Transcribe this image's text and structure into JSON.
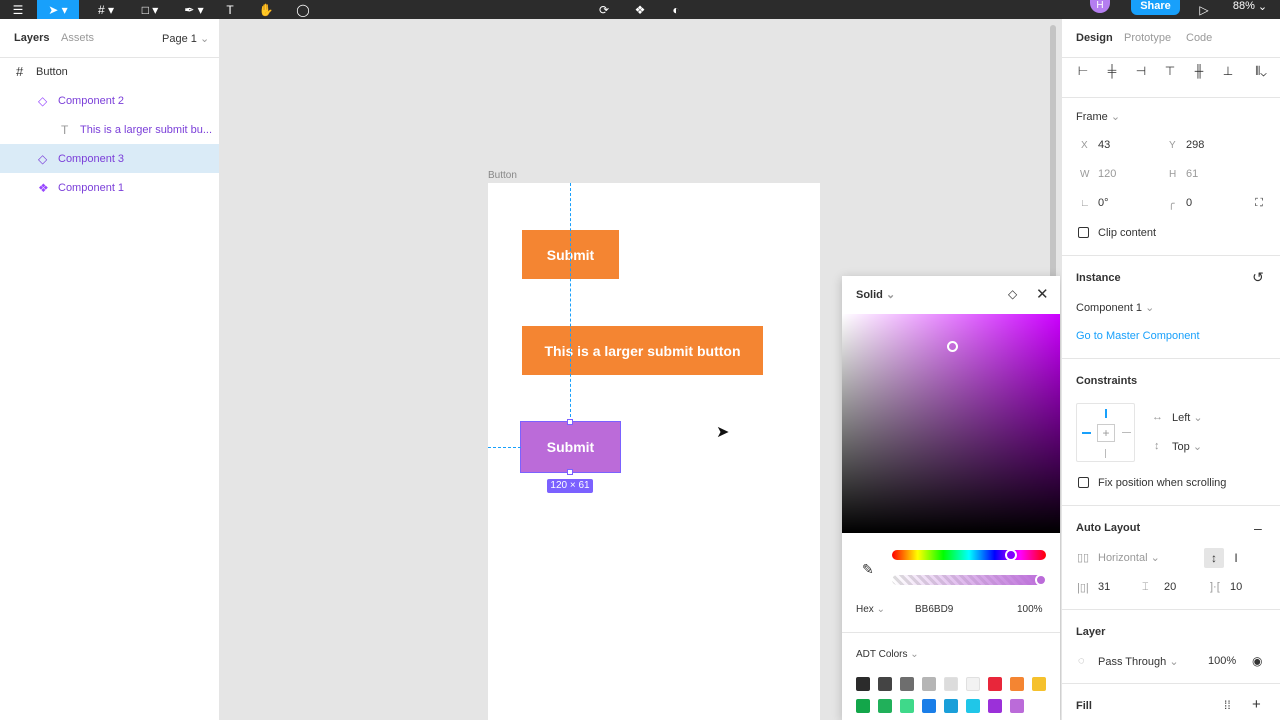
{
  "toolbar": {
    "icons": [
      "menu-icon",
      "move-tool-icon",
      "frame-tool-icon",
      "shape-tool-icon",
      "pen-tool-icon",
      "text-tool-icon",
      "hand-tool-icon",
      "comment-tool-icon"
    ],
    "center_icons": [
      "boolean-icon",
      "component-icon",
      "mask-icon"
    ],
    "avatar_letter": "H",
    "share_label": "Share",
    "zoom_label": "88%",
    "share_color": "#18a0fb",
    "avatar_color": "#b47ef0"
  },
  "left_panel": {
    "tabs": {
      "layers": "Layers",
      "assets": "Assets"
    },
    "page_selector": "Page 1",
    "layers": [
      {
        "icon": "frame-icon",
        "label": "Button"
      },
      {
        "icon": "component-instance-icon",
        "label": "Component 2"
      },
      {
        "icon": "text-layer-icon",
        "label": "This is a larger submit bu..."
      },
      {
        "icon": "component-instance-icon",
        "label": "Component 3"
      },
      {
        "icon": "main-component-icon",
        "label": "Component 1"
      }
    ]
  },
  "canvas": {
    "frame_label": "Button",
    "buttons": [
      {
        "label": "Submit"
      },
      {
        "label": "This is a larger submit button"
      },
      {
        "label": "Submit"
      }
    ],
    "size_badge": "120 × 61",
    "colors": {
      "orange": "#f48532",
      "purple": "#bb6bd9",
      "selection": "#7b61ff"
    }
  },
  "color_picker": {
    "fill_type": "Solid",
    "hex_mode": "Hex",
    "hex_value": "BB6BD9",
    "opacity": "100%",
    "library": "ADT Colors",
    "swatches": [
      "#2b2b2b",
      "#444444",
      "#6e6e6e",
      "#b5b5b5",
      "#dcdcdc",
      "#f2f2f2",
      "#e8263a",
      "#f48532",
      "#f5c12d",
      "#13a64a",
      "#21b05a",
      "#3fd98a",
      "#1a7ee8",
      "#1a9fd9",
      "#20c6e8",
      "#9b30d9",
      "#bb6bd9"
    ]
  },
  "right_panel": {
    "tabs": {
      "design": "Design",
      "prototype": "Prototype",
      "code": "Code"
    },
    "frame_section": {
      "title": "Frame",
      "x_label": "X",
      "x_value": "43",
      "y_label": "Y",
      "y_value": "298",
      "w_label": "W",
      "w_value": "120",
      "h_label": "H",
      "h_value": "61",
      "rotation": "0°",
      "radius": "0",
      "clip_content": "Clip content"
    },
    "instance": {
      "title": "Instance",
      "component": "Component 1",
      "master_link": "Go to Master Component"
    },
    "constraints": {
      "title": "Constraints",
      "horizontal": "Left",
      "vertical": "Top",
      "fix_position": "Fix position when scrolling"
    },
    "auto_layout": {
      "title": "Auto Layout",
      "direction": "Horizontal",
      "spacing": "31",
      "padding_v": "20",
      "padding_h": "10"
    },
    "layer": {
      "title": "Layer",
      "blend": "Pass Through",
      "opacity": "100%"
    },
    "fill": {
      "title": "Fill"
    }
  }
}
